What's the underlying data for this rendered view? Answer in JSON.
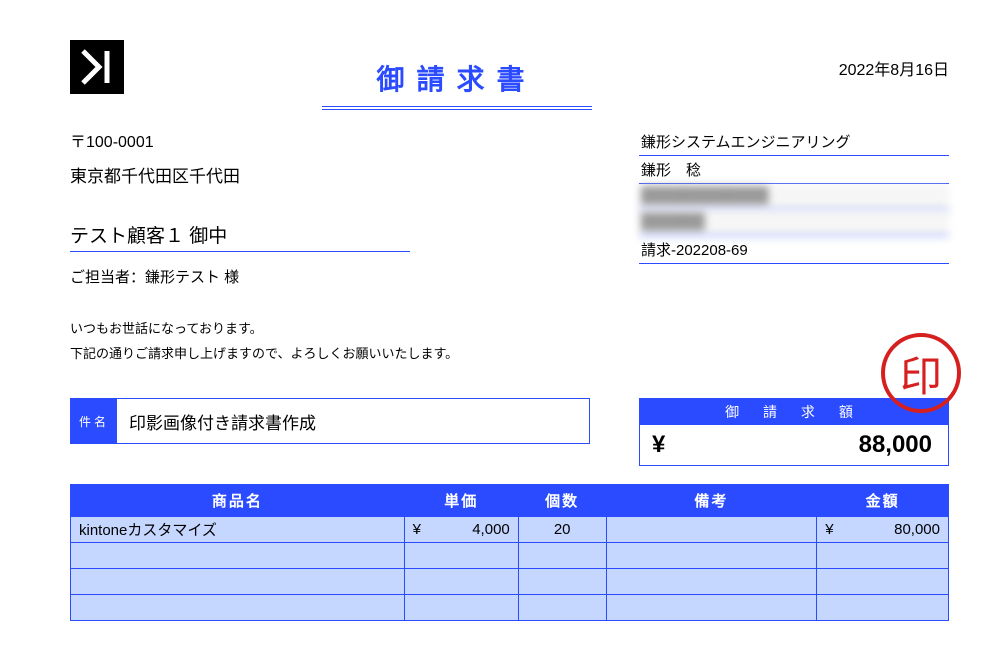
{
  "date": "2022年8月16日",
  "doc_title": "御請求書",
  "sender_postal": "〒100-0001",
  "sender_address": "東京都千代田区千代田",
  "client_name": "テスト顧客１ 御中",
  "contact_line": "ご担当者：鎌形テスト 様",
  "message_line1": "いつもお世話になっております。",
  "message_line2": "下記の通りご請求申し上げますので、よろしくお願いいたします。",
  "issuer_company": "鎌形システムエンジニアリング",
  "issuer_person": "鎌形　稔",
  "issuer_blur1": "████████████",
  "issuer_blur2": "██████",
  "invoice_no": "請求-202208-69",
  "stamp_char": "印",
  "subject_label": "件名",
  "subject_value": "印影画像付き請求書作成",
  "total_label": "御 請 求 額",
  "total_currency": "¥",
  "total_amount": "88,000",
  "table_headers": {
    "name": "商品名",
    "unit": "単価",
    "qty": "個数",
    "note": "備考",
    "amount": "金額"
  },
  "items": [
    {
      "name": "kintoneカスタマイズ",
      "unit_sym": "¥",
      "unit": "4,000",
      "qty": "20",
      "note": "",
      "amt_sym": "¥",
      "amount": "80,000"
    },
    {
      "name": "",
      "unit_sym": "",
      "unit": "",
      "qty": "",
      "note": "",
      "amt_sym": "",
      "amount": ""
    },
    {
      "name": "",
      "unit_sym": "",
      "unit": "",
      "qty": "",
      "note": "",
      "amt_sym": "",
      "amount": ""
    },
    {
      "name": "",
      "unit_sym": "",
      "unit": "",
      "qty": "",
      "note": "",
      "amt_sym": "",
      "amount": ""
    }
  ]
}
